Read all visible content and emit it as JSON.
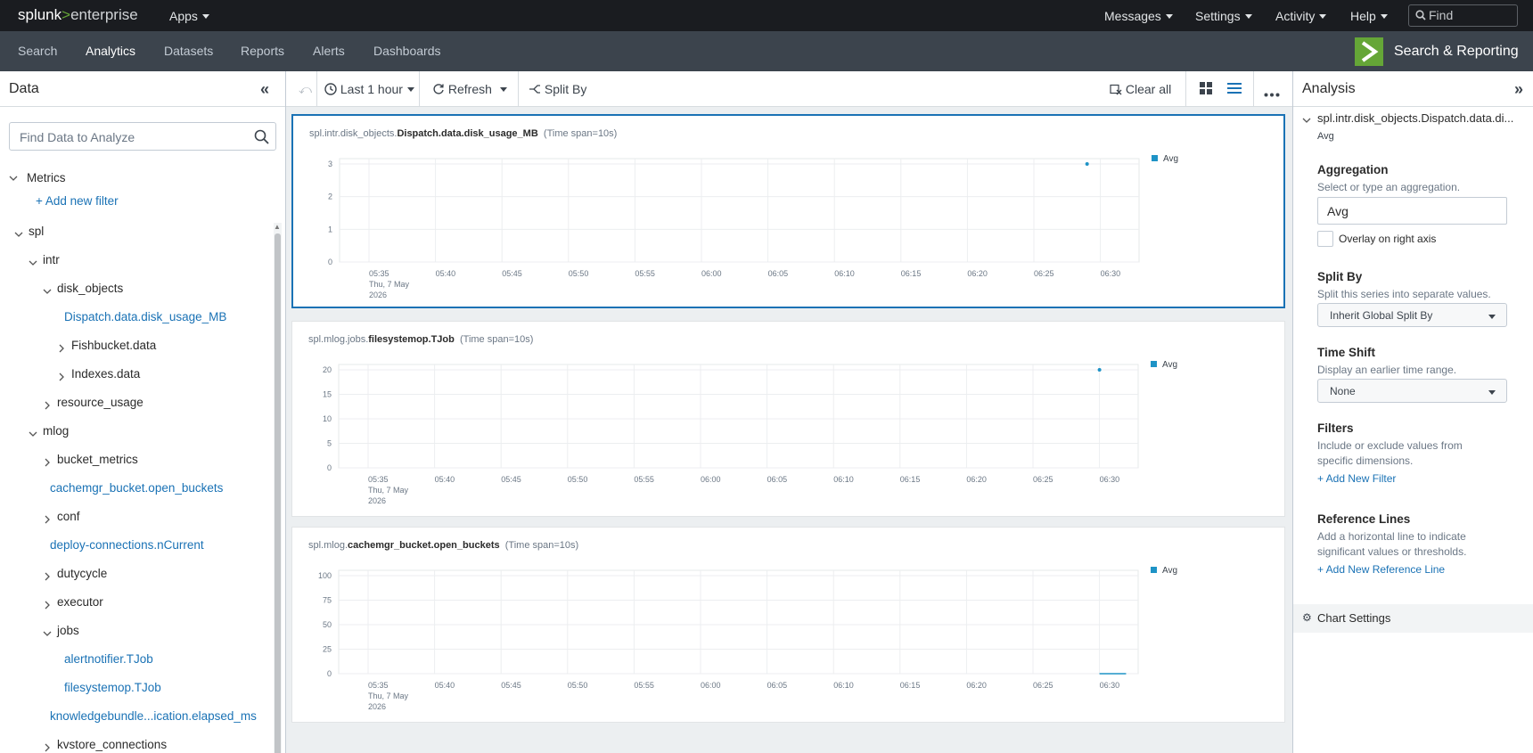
{
  "topbar": {
    "brand_splunk": "splunk",
    "brand_gt": ">",
    "brand_enterprise": "enterprise",
    "apps": "Apps",
    "messages": "Messages",
    "settings": "Settings",
    "activity": "Activity",
    "help": "Help",
    "find_placeholder": "Find"
  },
  "nav": {
    "items": [
      "Search",
      "Analytics",
      "Datasets",
      "Reports",
      "Alerts",
      "Dashboards"
    ],
    "active": "Analytics",
    "app_name": "Search & Reporting"
  },
  "left_panel": {
    "title": "Data",
    "search_placeholder": "Find Data to Analyze",
    "metrics": "Metrics",
    "add_filter": "+ Add new filter",
    "tree": [
      {
        "label": "spl",
        "chev": "v",
        "link": false
      },
      {
        "label": "intr",
        "chev": "v",
        "link": false
      },
      {
        "label": "disk_objects",
        "chev": "v",
        "link": false
      },
      {
        "label": "Dispatch.data.disk_usage_MB",
        "chev": "",
        "link": true
      },
      {
        "label": "Fishbucket.data",
        "chev": ">",
        "link": false
      },
      {
        "label": "Indexes.data",
        "chev": ">",
        "link": false
      },
      {
        "label": "resource_usage",
        "chev": ">",
        "link": false
      },
      {
        "label": "mlog",
        "chev": "v",
        "link": false
      },
      {
        "label": "bucket_metrics",
        "chev": ">",
        "link": false
      },
      {
        "label": "cachemgr_bucket.open_buckets",
        "chev": "",
        "link": true
      },
      {
        "label": "conf",
        "chev": ">",
        "link": false
      },
      {
        "label": "deploy-connections.nCurrent",
        "chev": "",
        "link": true
      },
      {
        "label": "dutycycle",
        "chev": ">",
        "link": false
      },
      {
        "label": "executor",
        "chev": ">",
        "link": false
      },
      {
        "label": "jobs",
        "chev": "v",
        "link": false
      },
      {
        "label": "alertnotifier.TJob",
        "chev": "",
        "link": true
      },
      {
        "label": "filesystemop.TJob",
        "chev": "",
        "link": true
      },
      {
        "label": "knowledgebundle...ication.elapsed_ms",
        "chev": "",
        "link": true
      },
      {
        "label": "kvstore_connections",
        "chev": ">",
        "link": false
      }
    ]
  },
  "toolbar": {
    "time_range": "Last 1 hour",
    "refresh": "Refresh",
    "split_by": "Split By",
    "clear_all": "Clear all"
  },
  "charts": [
    {
      "title_prefix": "spl.intr.disk_objects.",
      "title_bold": "Dispatch.data.disk_usage_MB",
      "span": "(Time span=10s)",
      "legend": "Avg",
      "selected": true,
      "chart_data": {
        "type": "line",
        "x": [
          "05:35",
          "05:40",
          "05:45",
          "05:50",
          "05:55",
          "06:00",
          "06:05",
          "06:10",
          "06:15",
          "06:20",
          "06:25",
          "06:30"
        ],
        "x_first_extra": [
          "Thu, 7 May",
          "2026"
        ],
        "yticks": [
          "0",
          "1",
          "2",
          "3"
        ],
        "ylim": [
          0,
          3
        ],
        "series": [
          {
            "name": "Avg",
            "points": [
              {
                "x": "06:29",
                "y": 3
              }
            ]
          }
        ],
        "grid": true,
        "legend_position": "right"
      }
    },
    {
      "title_prefix": "spl.mlog.jobs.",
      "title_bold": "filesystemop.TJob",
      "span": "(Time span=10s)",
      "legend": "Avg",
      "selected": false,
      "chart_data": {
        "type": "line",
        "x": [
          "05:35",
          "05:40",
          "05:45",
          "05:50",
          "05:55",
          "06:00",
          "06:05",
          "06:10",
          "06:15",
          "06:20",
          "06:25",
          "06:30"
        ],
        "x_first_extra": [
          "Thu, 7 May",
          "2026"
        ],
        "yticks": [
          "0",
          "5",
          "10",
          "15",
          "20"
        ],
        "ylim": [
          0,
          20
        ],
        "series": [
          {
            "name": "Avg",
            "points": [
              {
                "x": "06:30",
                "y": 20
              }
            ]
          }
        ],
        "grid": true,
        "legend_position": "right"
      }
    },
    {
      "title_prefix": "spl.mlog.",
      "title_bold": "cachemgr_bucket.open_buckets",
      "span": "(Time span=10s)",
      "legend": "Avg",
      "selected": false,
      "chart_data": {
        "type": "line",
        "x": [
          "05:35",
          "05:40",
          "05:45",
          "05:50",
          "05:55",
          "06:00",
          "06:05",
          "06:10",
          "06:15",
          "06:20",
          "06:25",
          "06:30"
        ],
        "x_first_extra": [
          "Thu, 7 May",
          "2026"
        ],
        "yticks": [
          "0",
          "25",
          "50",
          "75",
          "100"
        ],
        "ylim": [
          0,
          100
        ],
        "series": [
          {
            "name": "Avg",
            "points": [
              {
                "x": "06:30",
                "y": 0
              },
              {
                "x": "06:32",
                "y": 0
              }
            ]
          }
        ],
        "grid": true,
        "legend_position": "right"
      }
    }
  ],
  "analysis": {
    "title": "Analysis",
    "metric": "spl.intr.disk_objects.Dispatch.data.di...",
    "metric_sub": "Avg",
    "aggregation_title": "Aggregation",
    "aggregation_desc": "Select or type an aggregation.",
    "aggregation_value": "Avg",
    "overlay_label": "Overlay on right axis",
    "split_title": "Split By",
    "split_desc": "Split this series into separate values.",
    "split_value": "Inherit Global Split By",
    "shift_title": "Time Shift",
    "shift_desc": "Display an earlier time range.",
    "shift_value": "None",
    "filters_title": "Filters",
    "filters_desc": "Include or exclude values from specific dimensions.",
    "filters_link": "+ Add New Filter",
    "ref_title": "Reference Lines",
    "ref_desc": "Add a horizontal line to indicate significant values or thresholds.",
    "ref_link": "+ Add New Reference Line",
    "chart_settings": "Chart Settings"
  },
  "colors": {
    "accent_green": "#65a637",
    "link_blue": "#1a72b5",
    "series_blue": "#1e93c6"
  }
}
